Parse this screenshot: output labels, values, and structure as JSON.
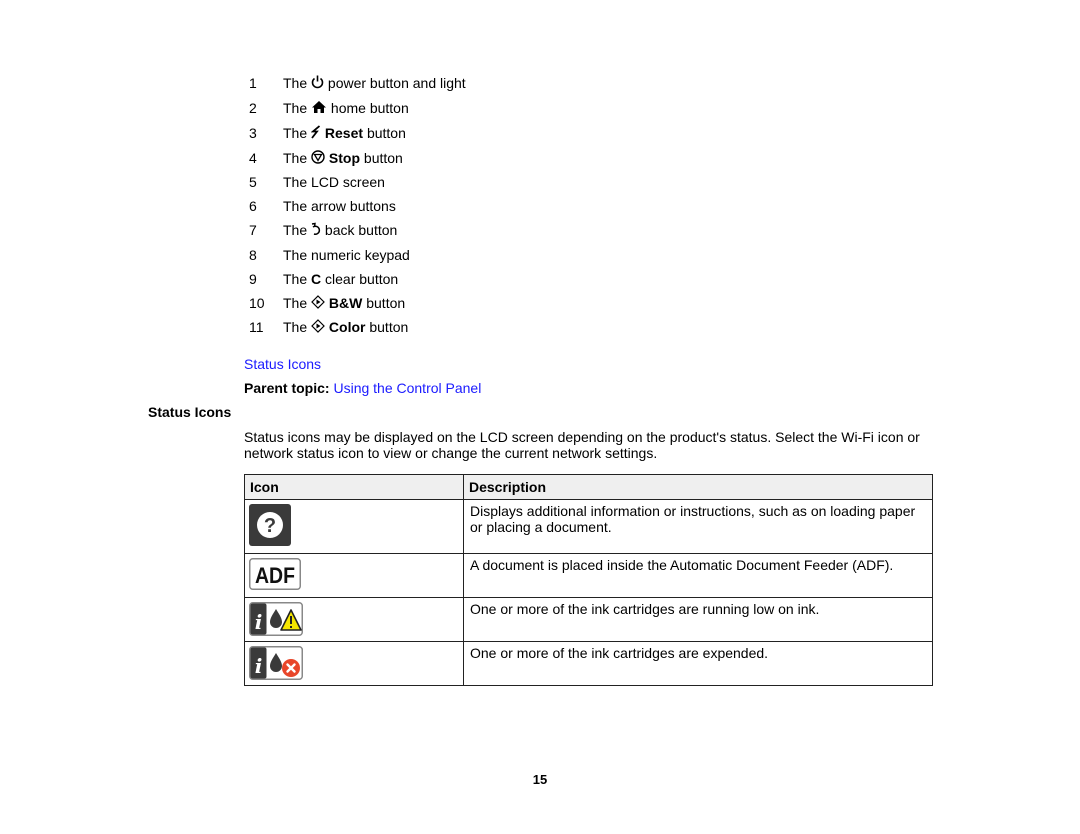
{
  "numbered_list": [
    {
      "num": "1",
      "pre": "The",
      "icon": "power-icon",
      "bold": "",
      "post": "power button and light"
    },
    {
      "num": "2",
      "pre": "The",
      "icon": "home-icon",
      "bold": "",
      "post": "home button"
    },
    {
      "num": "3",
      "pre": "The",
      "icon": "reset-icon",
      "bold": "Reset",
      "post": "button"
    },
    {
      "num": "4",
      "pre": "The",
      "icon": "stop-icon",
      "bold": "Stop",
      "post": "button"
    },
    {
      "num": "5",
      "pre": "The LCD screen",
      "icon": "",
      "bold": "",
      "post": ""
    },
    {
      "num": "6",
      "pre": "The arrow buttons",
      "icon": "",
      "bold": "",
      "post": ""
    },
    {
      "num": "7",
      "pre": "The",
      "icon": "back-icon",
      "bold": "",
      "post": "back button"
    },
    {
      "num": "8",
      "pre": "The numeric keypad",
      "icon": "",
      "bold": "",
      "post": ""
    },
    {
      "num": "9",
      "pre": "The",
      "icon": "",
      "bold": "C",
      "post": "clear button"
    },
    {
      "num": "10",
      "pre": "The",
      "icon": "start-diamond-icon",
      "bold": "B&W",
      "post": "button"
    },
    {
      "num": "11",
      "pre": "The",
      "icon": "start-diamond-icon",
      "bold": "Color",
      "post": "button"
    }
  ],
  "related_link": "Status Icons",
  "parent_topic": {
    "label": "Parent topic:",
    "link": "Using the Control Panel"
  },
  "section": {
    "title": "Status Icons",
    "intro": "Status icons may be displayed on the LCD screen depending on the product's status. Select the Wi-Fi icon or network status icon to view or change the current network settings."
  },
  "table": {
    "headers": [
      "Icon",
      "Description"
    ],
    "rows": [
      {
        "icon": "help-question-icon",
        "description": "Displays additional information or instructions, such as on loading paper or placing a document."
      },
      {
        "icon": "adf-icon",
        "icon_text": "ADF",
        "description": "A document is placed inside the Automatic Document Feeder (ADF)."
      },
      {
        "icon": "ink-low-warning-icon",
        "description": "One or more of the ink cartridges are running low on ink."
      },
      {
        "icon": "ink-expended-icon",
        "description": "One or more of the ink cartridges are expended."
      }
    ]
  },
  "colors": {
    "link": "#1a1aff",
    "header_bg": "#efefef",
    "warning": "#f5e600",
    "error": "#e8462a"
  },
  "page_number": "15"
}
